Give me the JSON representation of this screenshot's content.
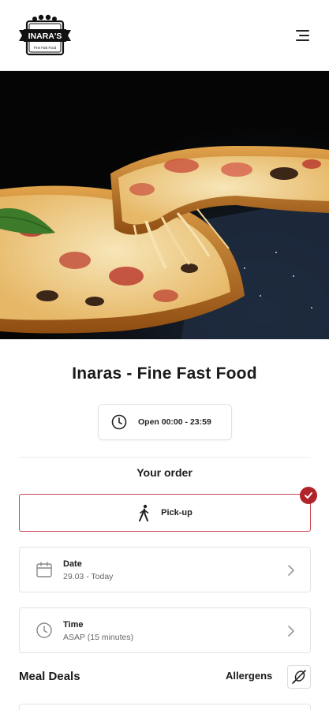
{
  "header": {
    "logo_text": "INARA'S",
    "logo_subtext": "Fine Fast Food",
    "menu_icon": "hamburger-menu-icon"
  },
  "hero": {
    "image_subject": "pizza-slice-photo"
  },
  "restaurant": {
    "name": "Inaras - Fine Fast Food",
    "hours": "Open 00:00 - 23:59",
    "hours_icon": "clock-icon"
  },
  "order": {
    "section_title": "Your order",
    "pickup_label": "Pick-up",
    "pickup_icon": "walking-person-icon",
    "selected_icon": "checkmark-icon",
    "accent_color": "#b0232b"
  },
  "date": {
    "label": "Date",
    "value": "29.03 - Today",
    "icon": "calendar-icon"
  },
  "time": {
    "label": "Time",
    "value": "ASAP (15 minutes)",
    "icon": "clock-icon"
  },
  "menu": {
    "section_title": "Meal Deals",
    "allergens_label": "Allergens",
    "allergens_icon": "allergen-filter-icon"
  }
}
